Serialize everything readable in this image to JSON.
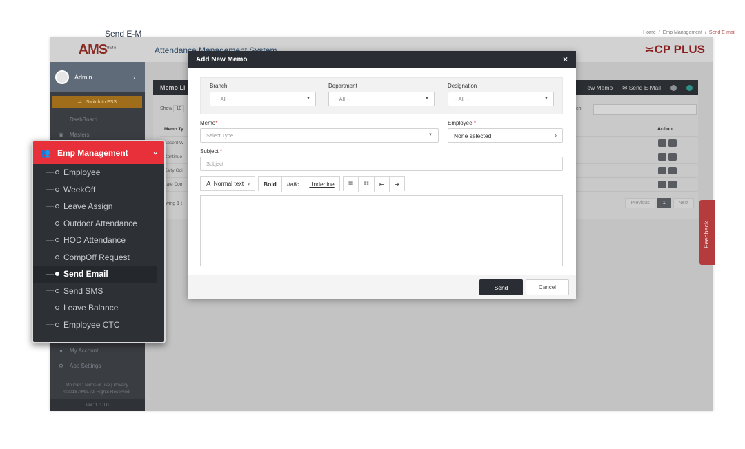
{
  "sidebar": {
    "logo": "AMS",
    "logo_badge": "BETA",
    "user": "Admin",
    "switch_label": "Switch to ESS",
    "items": [
      {
        "label": "DashBoard",
        "icon": "laptop-icon"
      },
      {
        "label": "Masters",
        "icon": "cube-icon"
      }
    ],
    "bottom_items": [
      {
        "label": "My Account",
        "icon": "user-icon"
      },
      {
        "label": "App Settings",
        "icon": "cogs-icon"
      }
    ],
    "policies_label": "Policies:",
    "terms_label": "Terms of use",
    "privacy_label": "Privacy",
    "copyright": "©2018 AMS. All Rights Reserved.",
    "version": "Ver: 1.0.0.0"
  },
  "header": {
    "app_title": "Attendance Management System",
    "brand": "CP PLUS",
    "page_title": "Send E-M",
    "breadcrumbs": [
      "Home",
      "Emp Management",
      "Send E-mail"
    ]
  },
  "panel": {
    "title": "Memo Li",
    "new_memo": "ew Memo",
    "send_email": "Send E-Mail",
    "show_label": "Show",
    "show_value": "10",
    "search_label": "earch:",
    "columns": {
      "memo_type": "Memo Ty",
      "action": "Action"
    },
    "rows": [
      "Absent W",
      "Continuo",
      "Early Goi",
      "Late Com"
    ],
    "showing": "howing 1 t",
    "pagination": {
      "prev": "Previous",
      "current": "1",
      "next": "Next"
    }
  },
  "feedback": "Feedback",
  "modal": {
    "title": "Add New Memo",
    "close": "×",
    "filters": [
      {
        "label": "Branch",
        "value": "-- All --"
      },
      {
        "label": "Department",
        "value": "-- All --"
      },
      {
        "label": "Designation",
        "value": "-- All --"
      }
    ],
    "memo_label": "Memo",
    "memo_placeholder": "Select Type",
    "employee_label": "Employee",
    "employee_value": "None selected",
    "subject_label": "Subject",
    "subject_placeholder": "Subject",
    "required_mark": "*",
    "toolbar": {
      "format": "Normal text",
      "bold": "Bold",
      "italic": "Italic",
      "underline": "Underline"
    },
    "send_label": "Send",
    "cancel_label": "Cancel"
  },
  "emp_menu": {
    "title": "Emp Management",
    "items": [
      {
        "label": "Employee",
        "active": false
      },
      {
        "label": "WeekOff",
        "active": false
      },
      {
        "label": "Leave Assign",
        "active": false
      },
      {
        "label": "Outdoor Attendance",
        "active": false
      },
      {
        "label": "HOD Attendance",
        "active": false
      },
      {
        "label": "CompOff Request",
        "active": false
      },
      {
        "label": "Send Email",
        "active": true
      },
      {
        "label": "Send SMS",
        "active": false
      },
      {
        "label": "Leave Balance",
        "active": false
      },
      {
        "label": "Employee CTC",
        "active": false
      }
    ]
  },
  "colors": {
    "accent_red": "#e8303a",
    "dark": "#2a2d33",
    "brand_red": "#8a1f1f"
  }
}
